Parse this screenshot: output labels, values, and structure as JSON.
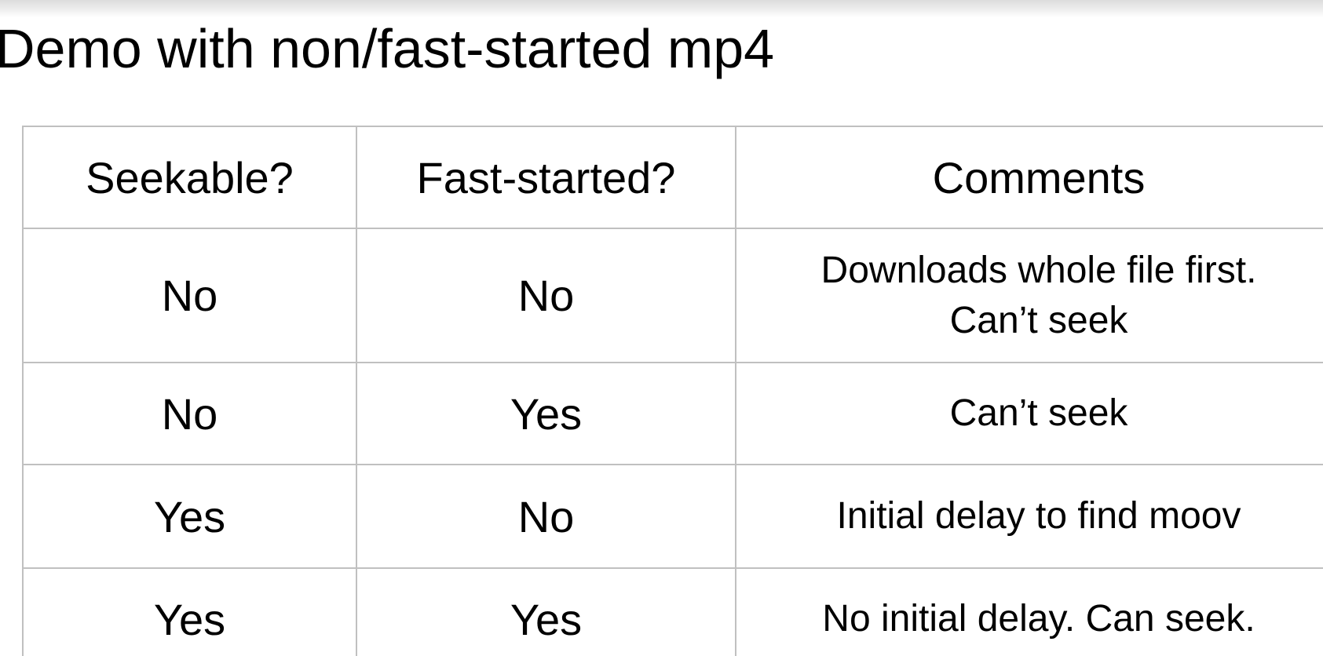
{
  "title": "Demo with non/fast-started mp4",
  "table": {
    "headers": [
      "Seekable?",
      "Fast-started?",
      "Comments"
    ],
    "rows": [
      {
        "seekable": "No",
        "fast_started": "No",
        "comments": [
          "Downloads whole file first.",
          "Can’t seek"
        ]
      },
      {
        "seekable": "No",
        "fast_started": "Yes",
        "comments": [
          "Can’t seek"
        ]
      },
      {
        "seekable": "Yes",
        "fast_started": "No",
        "comments": [
          "Initial delay to find moov"
        ]
      },
      {
        "seekable": "Yes",
        "fast_started": "Yes",
        "comments": [
          "No initial delay. Can seek."
        ]
      }
    ]
  }
}
